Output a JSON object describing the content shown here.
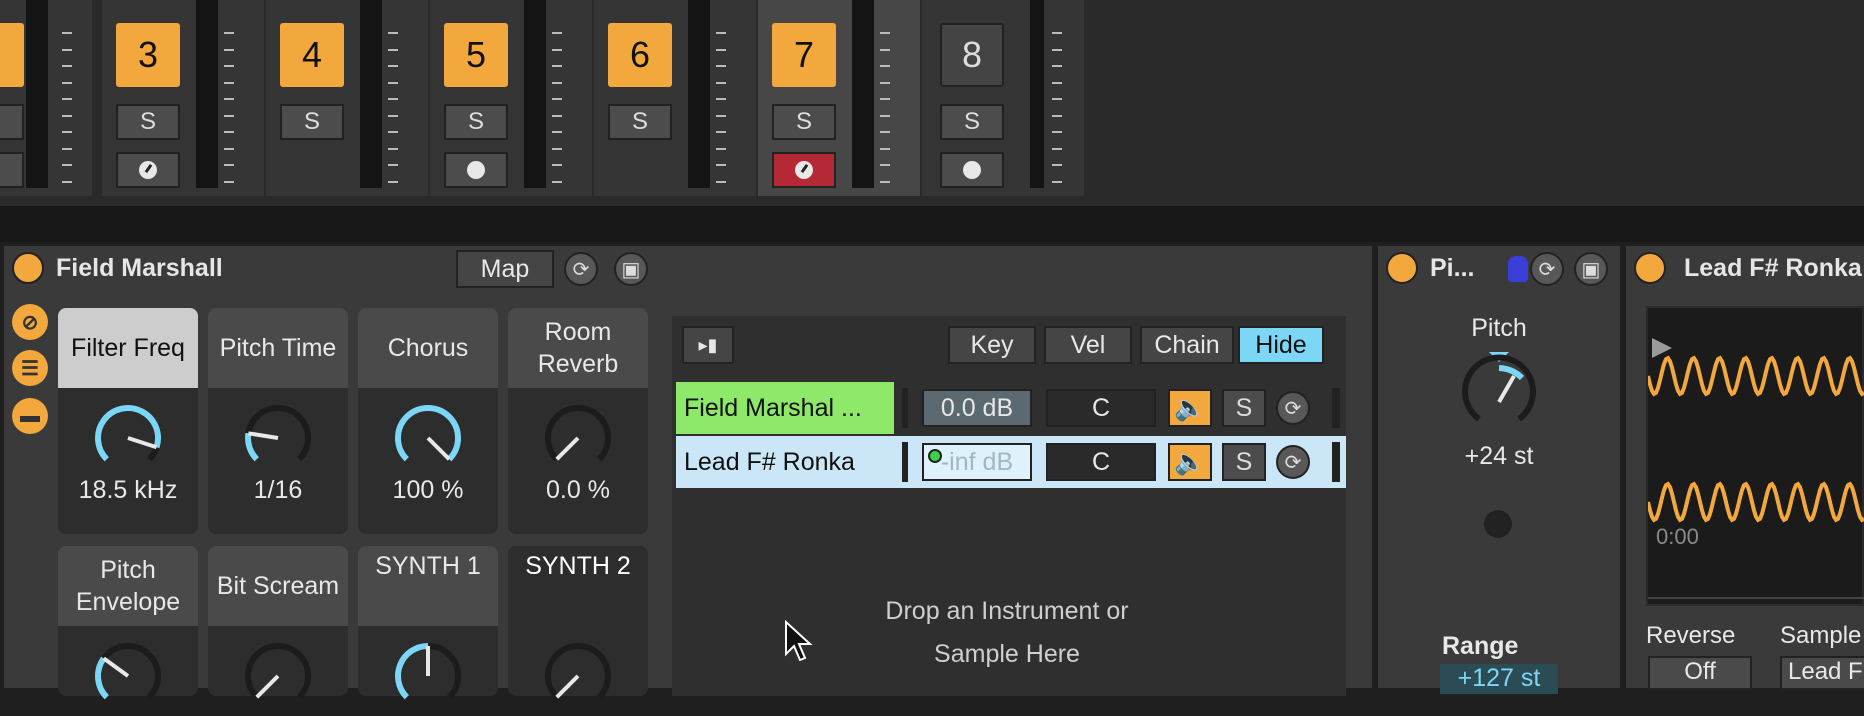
{
  "mixer": {
    "tracks": [
      {
        "number": "3",
        "solo": "S",
        "arm": "clock",
        "active": true
      },
      {
        "number": "4",
        "solo": "S",
        "arm": "",
        "active": true
      },
      {
        "number": "5",
        "solo": "S",
        "arm": "dot",
        "active": true
      },
      {
        "number": "6",
        "solo": "S",
        "arm": "",
        "active": true
      },
      {
        "number": "7",
        "solo": "S",
        "arm": "clock-armed",
        "active": true,
        "selected": true
      },
      {
        "number": "8",
        "solo": "S",
        "arm": "dot",
        "active": false
      }
    ]
  },
  "rack": {
    "title": "Field Marshall",
    "map_label": "Map",
    "macros": [
      {
        "name": "Filter Freq",
        "value": "18.5 kHz",
        "knob_fraction": 0.9
      },
      {
        "name": "Pitch Time",
        "value": "1/16",
        "knob_fraction": 0.2
      },
      {
        "name": "Chorus",
        "value": "100 %",
        "knob_fraction": 1.0
      },
      {
        "name": "Room Reverb",
        "value": "0.0 %",
        "knob_fraction": 0.0
      },
      {
        "name": "Pitch Envelope",
        "value": "",
        "knob_fraction": 0.3
      },
      {
        "name": "Bit Scream",
        "value": "",
        "knob_fraction": 0.0
      },
      {
        "name": "SYNTH 1",
        "value": "",
        "knob_fraction": 0.5
      },
      {
        "name": "SYNTH 2",
        "value": "",
        "knob_fraction": 0.0
      }
    ],
    "chain_tabs": {
      "key": "Key",
      "vel": "Vel",
      "chain": "Chain",
      "hide": "Hide"
    },
    "chains": [
      {
        "name": "Field Marshal ...",
        "volume": "0.0 dB",
        "pan": "C",
        "solo": "S",
        "color": "#8ee86a"
      },
      {
        "name": "Lead F# Ronka",
        "volume": "-inf dB",
        "pan": "C",
        "solo": "S",
        "color": "#cbe7f7"
      }
    ],
    "drop_hint_line1": "Drop an Instrument or",
    "drop_hint_line2": "Sample Here"
  },
  "pitch_device": {
    "title": "Pi...",
    "knob_label": "Pitch",
    "knob_value": "+24 st",
    "range_label": "Range",
    "range_value": "+127 st"
  },
  "sampler": {
    "title": "Lead F# Ronka",
    "time_label": "0:00",
    "reverse_label": "Reverse",
    "reverse_value": "Off",
    "sample_label": "Sample",
    "sample_value": "Lead F"
  },
  "colors": {
    "accent": "#f2a83c",
    "armed": "#b52836",
    "hide_active": "#7cd6f5",
    "wave": "#f2a83c"
  }
}
